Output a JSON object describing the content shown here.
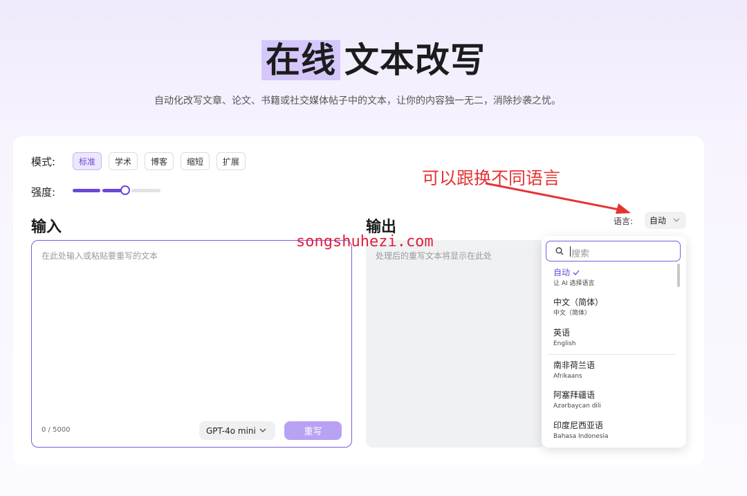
{
  "hero": {
    "title_highlight": "在线",
    "title_rest": "文本改写",
    "subtitle": "自动化改写文章、论文、书籍或社交媒体帖子中的文本，让你的内容独一无二，消除抄袭之忧。"
  },
  "mode": {
    "label": "模式:",
    "options": [
      "标准",
      "学术",
      "博客",
      "缩短",
      "扩展"
    ],
    "selected": "标准"
  },
  "strength": {
    "label": "强度:",
    "level": 3,
    "max": 4
  },
  "input": {
    "title": "输入",
    "placeholder": "在此处输入或粘贴要重写的文本",
    "counter": "0 / 5000",
    "model": "GPT-4o mini",
    "submit_label": "重写"
  },
  "output": {
    "title": "输出",
    "placeholder": "处理后的重写文本将显示在此处",
    "language_label": "语言:",
    "language_value": "自动"
  },
  "language_dropdown": {
    "search_placeholder": "搜索",
    "items": [
      {
        "name": "自动",
        "native": "让 AI 选择语言",
        "selected": true
      },
      {
        "name": "中文（简体）",
        "native": "中文（简体）",
        "selected": false
      },
      {
        "name": "英语",
        "native": "English",
        "selected": false
      },
      {
        "name": "南非荷兰语",
        "native": "Afrikaans",
        "selected": false
      },
      {
        "name": "阿塞拜疆语",
        "native": "Azərbaycan dili",
        "selected": false
      },
      {
        "name": "印度尼西亚语",
        "native": "Bahasa Indonesia",
        "selected": false
      }
    ]
  },
  "overlay": {
    "watermark": "songshuhezi.com",
    "annotation": "可以跟换不同语言"
  },
  "colors": {
    "accent": "#6a47d8",
    "highlight": "#d6c7fb",
    "annotation_red": "#e53333"
  }
}
